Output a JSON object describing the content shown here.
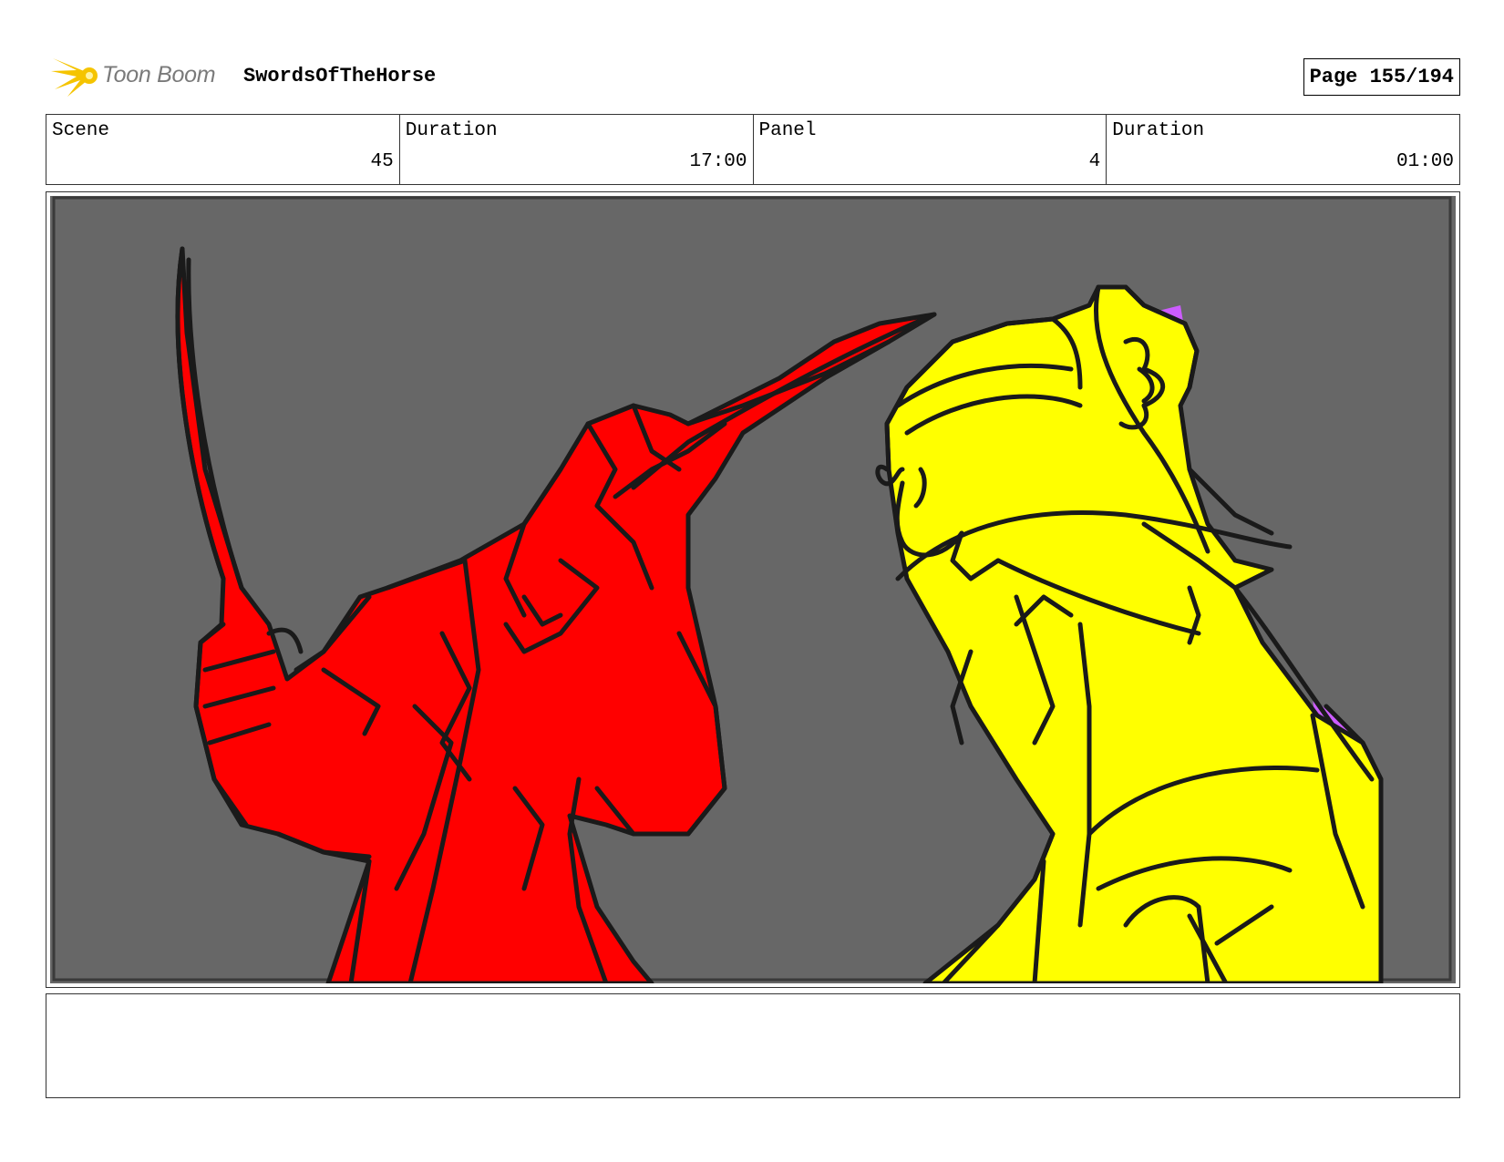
{
  "header": {
    "logo_text": "Toon Boom",
    "project_title": "SwordsOfTheHorse",
    "page_label": "Page 155/194"
  },
  "info": {
    "scene_label": "Scene",
    "scene_value": "45",
    "scene_duration_label": "Duration",
    "scene_duration_value": "17:00",
    "panel_label": "Panel",
    "panel_value": "4",
    "panel_duration_label": "Duration",
    "panel_duration_value": "01:00"
  },
  "notes": {
    "text": ""
  },
  "colors": {
    "panel_background": "#676767",
    "red_character": "#ff0000",
    "yellow_character": "#ffff00",
    "purple_accent": "#cc5cff",
    "logo_accent": "#f5c400"
  }
}
